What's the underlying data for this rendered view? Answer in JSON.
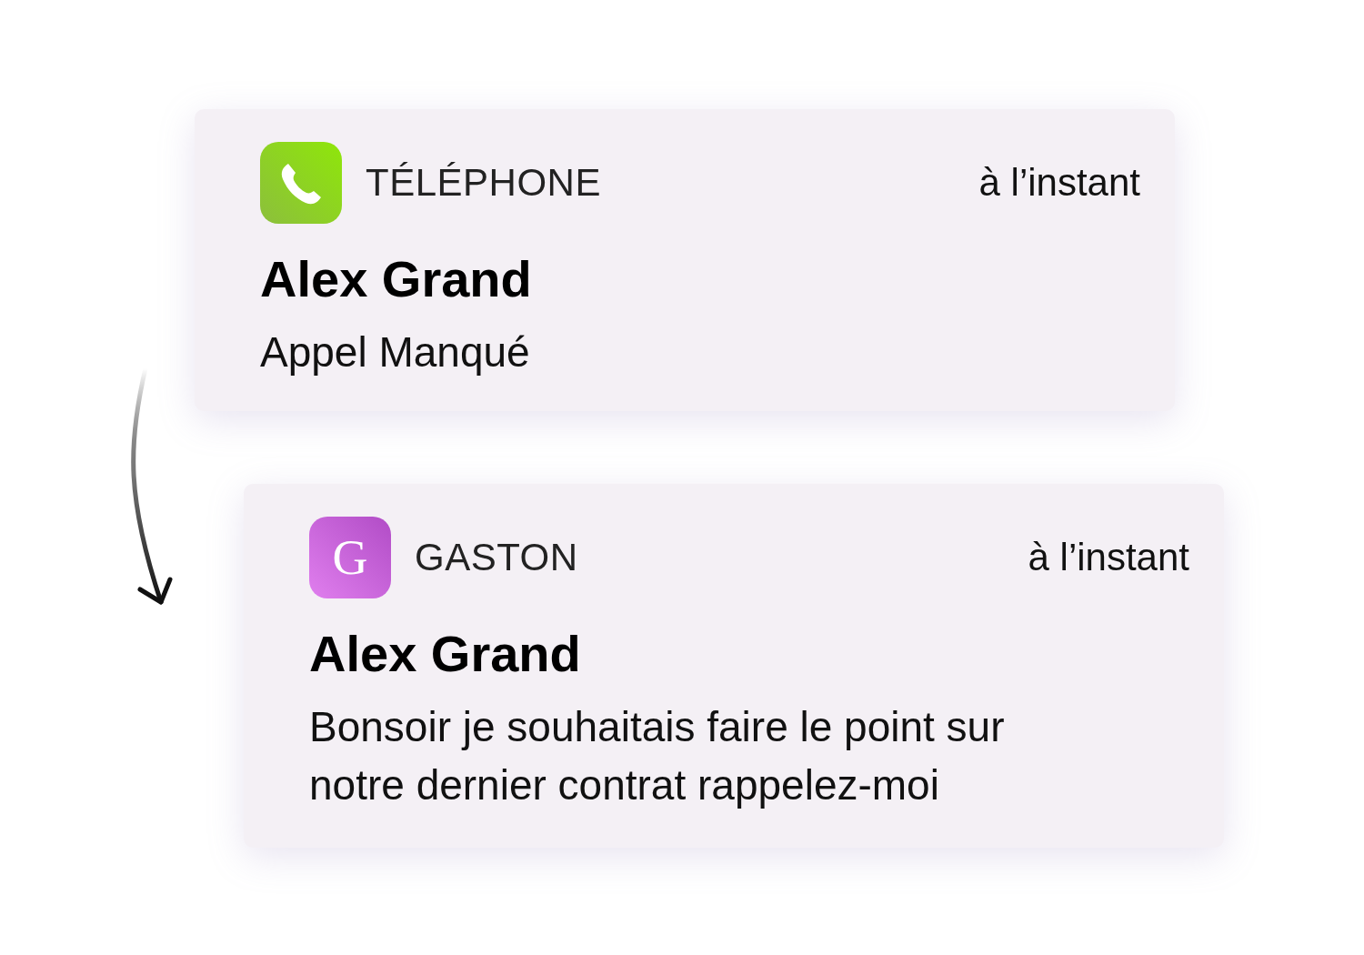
{
  "notifications": [
    {
      "kind": "phone",
      "app": "TÉLÉPHONE",
      "time": "à l’instant",
      "title": "Alex Grand",
      "body": "Appel Manqué"
    },
    {
      "kind": "letter",
      "icon_letter": "G",
      "app": "GASTON",
      "time": "à l’instant",
      "title": "Alex Grand",
      "body": "Bonsoir je souhaitais faire le point sur notre dernier contrat rappelez-moi"
    }
  ]
}
